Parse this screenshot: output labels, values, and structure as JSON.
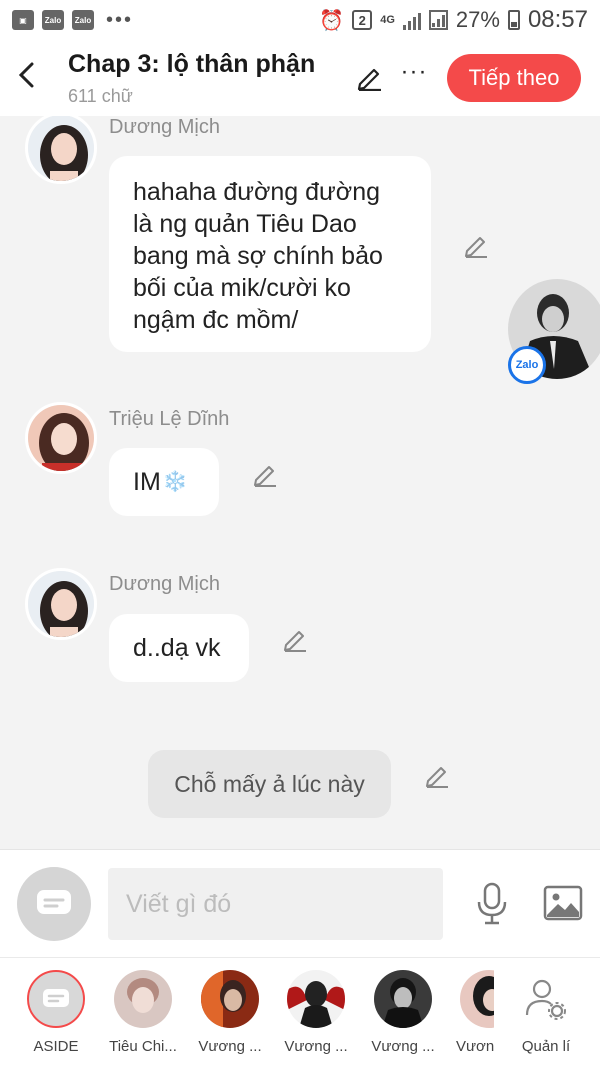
{
  "status_bar": {
    "left_icons": [
      "gallery-icon",
      "zalo-icon",
      "zalo-icon"
    ],
    "battery": "27%",
    "time": "08:57",
    "network": "4G",
    "notification_count": "2"
  },
  "header": {
    "title": "Chap 3: lộ thân phận",
    "subtitle": "611 chữ",
    "more_label": "···",
    "next_label": "Tiếp theo",
    "next_color": "#f44a4a"
  },
  "messages": [
    {
      "sender": "Dương Mịch",
      "lines": [
        "hahaha đường đường",
        "là ng quản Tiêu Dao",
        "bang mà sợ chính bảo",
        "bối của mik/cười ko",
        "ngậm đc mồm/"
      ]
    },
    {
      "sender": "Triệu Lệ Dĩnh",
      "text": "IM",
      "emoji": "❄️"
    },
    {
      "sender": "Dương Mịch",
      "text": "d..dạ vk"
    }
  ],
  "narration": "Chỗ mấy ả lúc này",
  "floating_badge": "Zalo",
  "input": {
    "placeholder": "Viết gì đó"
  },
  "characters": [
    {
      "name": "ASIDE"
    },
    {
      "name": "Tiêu Chi..."
    },
    {
      "name": "Vương ..."
    },
    {
      "name": "Vương ..."
    },
    {
      "name": "Vương ..."
    },
    {
      "name": "Vươn"
    },
    {
      "name": "Quản lí"
    }
  ]
}
